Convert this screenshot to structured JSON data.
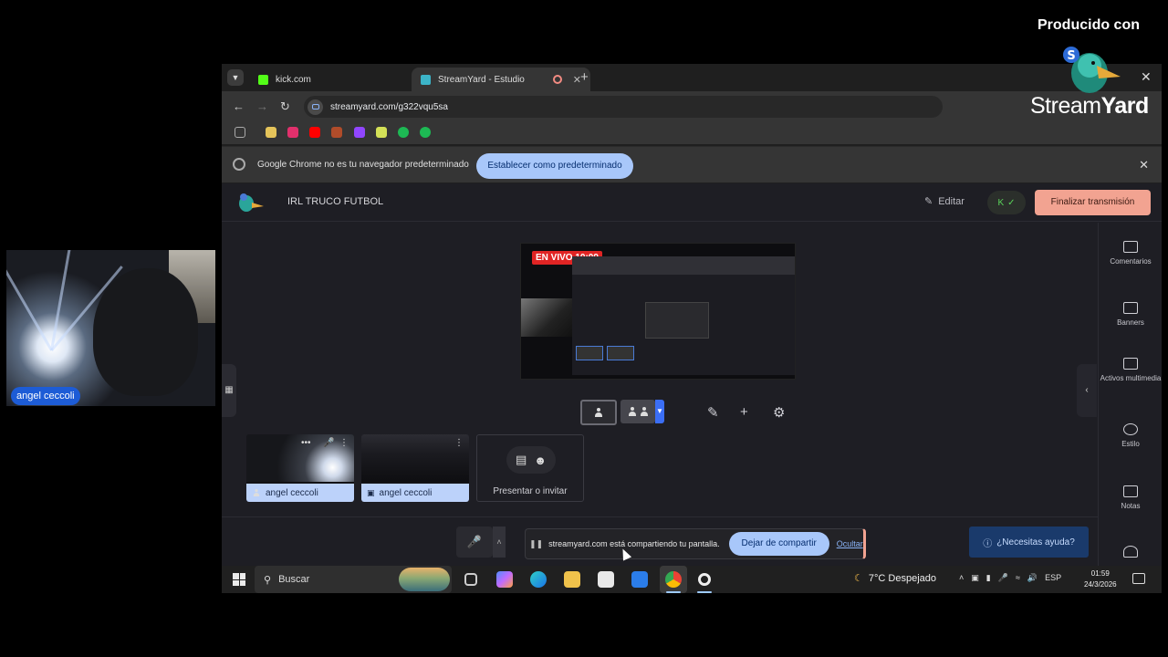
{
  "chrome": {
    "tabs": [
      {
        "title": "kick.com",
        "favicon_color": "#53fc18"
      },
      {
        "title": "StreamYard - Estudio",
        "favicon_color": "#3cb4c8"
      }
    ],
    "address": "streamyard.com/g322vqu5sa",
    "bookmark_colors": [
      "#e5c45a",
      "#e1306c",
      "#ff0000",
      "#b04c2a",
      "#9146ff",
      "#d4e157",
      "#1db954",
      "#1db954"
    ],
    "infobar": {
      "message": "Google Chrome no es tu navegador predeterminado",
      "button": "Establecer como predeterminado"
    }
  },
  "app": {
    "title": "IRL TRUCO FUTBOL",
    "edit_label": "Editar",
    "end_button": "Finalizar transmisión",
    "live_badge": "EN VIVO 10:09",
    "participants": [
      {
        "name": "angel ceccoli",
        "type": "camera"
      },
      {
        "name": "angel ceccoli",
        "type": "screen"
      }
    ],
    "invite_label": "Presentar o invitar",
    "sidebar": [
      {
        "label": "Comentarios",
        "icon": "comment-icon"
      },
      {
        "label": "Banners",
        "icon": "banner-icon"
      },
      {
        "label": "Activos multimedia",
        "icon": "media-icon"
      },
      {
        "label": "Estilo",
        "icon": "palette-icon"
      },
      {
        "label": "Notas",
        "icon": "notes-icon"
      }
    ],
    "share_bar": {
      "message": "streamyard.com está compartiendo tu pantalla.",
      "stop_button": "Dejar de compartir",
      "hide_link": "Ocultar"
    },
    "help_button": "¿Necesitas ayuda?"
  },
  "overlay": {
    "webcam_name": "angel ceccoli",
    "produced_with": "Producido con",
    "brand_a": "Stream",
    "brand_b": "Yard"
  },
  "taskbar": {
    "search": "Buscar",
    "weather": "7°C  Despejado",
    "lang": "ESP",
    "time": "01:59",
    "date": "24/3/2026"
  }
}
